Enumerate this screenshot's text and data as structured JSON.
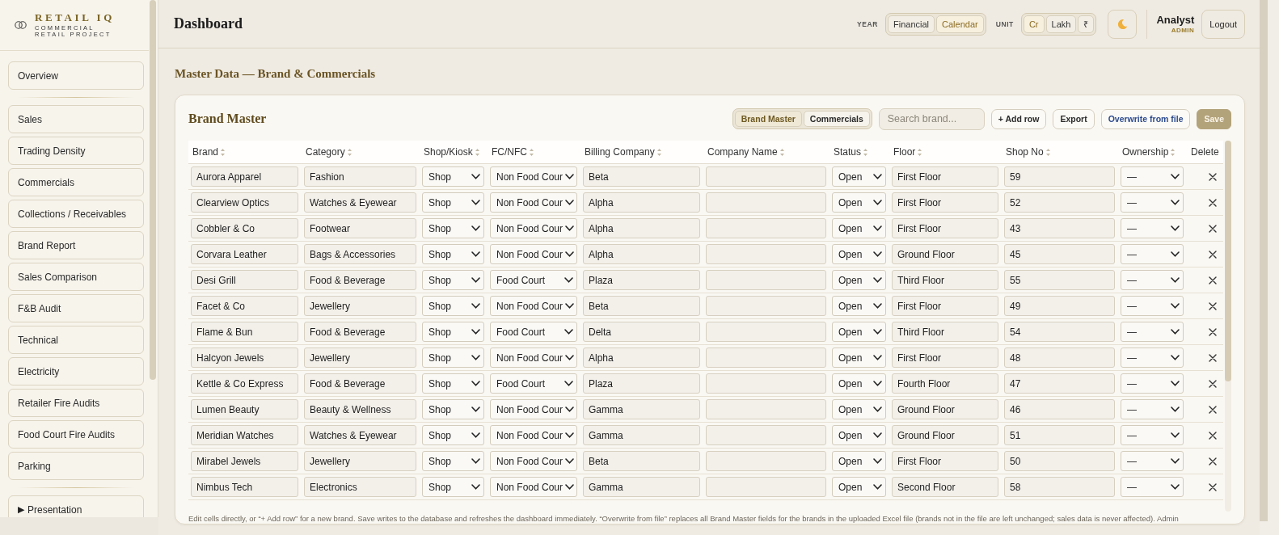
{
  "sidebar": {
    "brand": {
      "title": "RETAIL IQ",
      "subtitle": "COMMERCIAL RETAIL PROJECT"
    },
    "groups": [
      {
        "items": [
          {
            "label": "Overview",
            "selected": false
          }
        ]
      },
      {
        "items": [
          {
            "label": "Sales",
            "selected": false
          },
          {
            "label": "Trading Density",
            "selected": false
          },
          {
            "label": "Commercials",
            "selected": false
          },
          {
            "label": "Collections / Receivables",
            "selected": false
          },
          {
            "label": "Brand Report",
            "selected": false
          },
          {
            "label": "Sales Comparison",
            "selected": false
          },
          {
            "label": "F&B Audit",
            "selected": false
          },
          {
            "label": "Technical",
            "selected": false
          },
          {
            "label": "Electricity",
            "selected": false
          },
          {
            "label": "Retailer Fire Audits",
            "selected": false
          },
          {
            "label": "Food Court Fire Audits",
            "selected": false
          },
          {
            "label": "Parking",
            "selected": false
          }
        ]
      },
      {
        "items": [
          {
            "marker": "▶",
            "label": "Presentation",
            "selected": false
          }
        ]
      }
    ]
  },
  "header": {
    "title": "Dashboard",
    "year": {
      "label": "YEAR",
      "options": [
        {
          "label": "Financial",
          "selected": false
        },
        {
          "label": "Calendar",
          "selected": true
        }
      ]
    },
    "unit": {
      "label": "UNIT",
      "options": [
        {
          "label": "Cr",
          "selected": true
        },
        {
          "label": "Lakh",
          "selected": false
        },
        {
          "label": "₹",
          "selected": false
        }
      ]
    },
    "user": {
      "name": "Analyst",
      "role": "ADMIN"
    },
    "logout": "Logout"
  },
  "section_title": "Master Data — Brand & Commercials",
  "card": {
    "title": "Brand Master",
    "views": [
      {
        "label": "Brand Master",
        "selected": true
      },
      {
        "label": "Commercials",
        "selected": false
      }
    ],
    "search": {
      "placeholder": "Search brand..."
    },
    "buttons": [
      {
        "label": "+ Add row",
        "kind": "default",
        "disabled": false
      },
      {
        "label": "Export",
        "kind": "default",
        "disabled": false
      },
      {
        "label": "Overwrite from file",
        "kind": "accent",
        "disabled": false
      },
      {
        "label": "Save",
        "kind": "primary",
        "disabled": true
      }
    ],
    "table": {
      "columns": [
        {
          "label": "Brand",
          "kind": "field",
          "sortable": true
        },
        {
          "label": "Category",
          "kind": "field",
          "sortable": true
        },
        {
          "label": "Shop/Kiosk",
          "kind": "select",
          "sortable": true
        },
        {
          "label": "FC/NFC",
          "kind": "select",
          "sortable": true
        },
        {
          "label": "Billing Company",
          "kind": "field",
          "sortable": true
        },
        {
          "label": "Company Name",
          "kind": "field",
          "sortable": true
        },
        {
          "label": "Status",
          "kind": "select",
          "sortable": true
        },
        {
          "label": "Floor",
          "kind": "field",
          "sortable": true
        },
        {
          "label": "Shop No",
          "kind": "field",
          "sortable": true
        },
        {
          "label": "Ownership",
          "kind": "select",
          "sortable": true
        },
        {
          "label": "Delete",
          "kind": "delete",
          "sortable": false
        }
      ],
      "rows": [
        {
          "brand": "Aurora Apparel",
          "category": "Fashion",
          "shop_kiosk": "Shop",
          "fc_nfc": "Non Food Cour",
          "billing_company": "Beta",
          "status": "Open",
          "floor": "First Floor",
          "shop_no": "59",
          "ownership": "—"
        },
        {
          "brand": "Clearview Optics",
          "category": "Watches & Eyewear",
          "shop_kiosk": "Shop",
          "fc_nfc": "Non Food Cour",
          "billing_company": "Alpha",
          "status": "Open",
          "floor": "First Floor",
          "shop_no": "52",
          "ownership": "—"
        },
        {
          "brand": "Cobbler & Co",
          "category": "Footwear",
          "shop_kiosk": "Shop",
          "fc_nfc": "Non Food Cour",
          "billing_company": "Alpha",
          "status": "Open",
          "floor": "First Floor",
          "shop_no": "43",
          "ownership": "—"
        },
        {
          "brand": "Corvara Leather",
          "category": "Bags & Accessories",
          "shop_kiosk": "Shop",
          "fc_nfc": "Non Food Cour",
          "billing_company": "Alpha",
          "status": "Open",
          "floor": "Ground Floor",
          "shop_no": "45",
          "ownership": "—"
        },
        {
          "brand": "Desi Grill",
          "category": "Food & Beverage",
          "shop_kiosk": "Shop",
          "fc_nfc": "Food Court",
          "billing_company": "Plaza",
          "status": "Open",
          "floor": "Third Floor",
          "shop_no": "55",
          "ownership": "—"
        },
        {
          "brand": "Facet & Co",
          "category": "Jewellery",
          "shop_kiosk": "Shop",
          "fc_nfc": "Non Food Cour",
          "billing_company": "Beta",
          "status": "Open",
          "floor": "First Floor",
          "shop_no": "49",
          "ownership": "—"
        },
        {
          "brand": "Flame & Bun",
          "category": "Food & Beverage",
          "shop_kiosk": "Shop",
          "fc_nfc": "Food Court",
          "billing_company": "Delta",
          "status": "Open",
          "floor": "Third Floor",
          "shop_no": "54",
          "ownership": "—"
        },
        {
          "brand": "Halcyon Jewels",
          "category": "Jewellery",
          "shop_kiosk": "Shop",
          "fc_nfc": "Non Food Cour",
          "billing_company": "Alpha",
          "status": "Open",
          "floor": "First Floor",
          "shop_no": "48",
          "ownership": "—"
        },
        {
          "brand": "Kettle & Co Express",
          "category": "Food & Beverage",
          "shop_kiosk": "Shop",
          "fc_nfc": "Food Court",
          "billing_company": "Plaza",
          "status": "Open",
          "floor": "Fourth Floor",
          "shop_no": "47",
          "ownership": "—"
        },
        {
          "brand": "Lumen Beauty",
          "category": "Beauty & Wellness",
          "shop_kiosk": "Shop",
          "fc_nfc": "Non Food Cour",
          "billing_company": "Gamma",
          "status": "Open",
          "floor": "Ground Floor",
          "shop_no": "46",
          "ownership": "—"
        },
        {
          "brand": "Meridian Watches",
          "category": "Watches & Eyewear",
          "shop_kiosk": "Shop",
          "fc_nfc": "Non Food Cour",
          "billing_company": "Gamma",
          "status": "Open",
          "floor": "Ground Floor",
          "shop_no": "51",
          "ownership": "—"
        },
        {
          "brand": "Mirabel Jewels",
          "category": "Jewellery",
          "shop_kiosk": "Shop",
          "fc_nfc": "Non Food Cour",
          "billing_company": "Beta",
          "status": "Open",
          "floor": "First Floor",
          "shop_no": "50",
          "ownership": "—"
        },
        {
          "brand": "Nimbus Tech",
          "category": "Electronics",
          "shop_kiosk": "Shop",
          "fc_nfc": "Non Food Cour",
          "billing_company": "Gamma",
          "status": "Open",
          "floor": "Second Floor",
          "shop_no": "58",
          "ownership": "—"
        }
      ]
    },
    "note": "Edit cells directly, or “+ Add row” for a new brand. Save writes to the database and refreshes the dashboard immediately. “Overwrite from file” replaces all Brand Master fields for the brands in the uploaded Excel file (brands not in the file are left unchanged; sales data is never affected). Admin"
  }
}
